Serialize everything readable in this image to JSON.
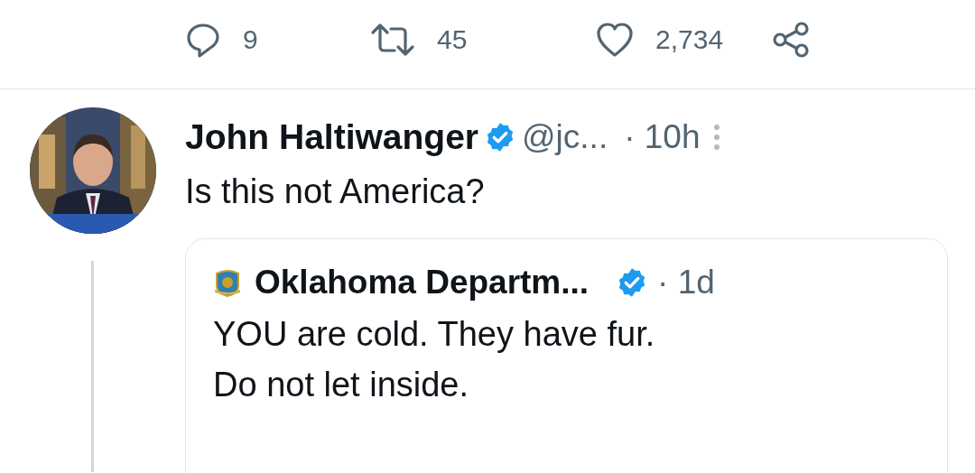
{
  "actions": [
    {
      "kind": "reply",
      "count": "9"
    },
    {
      "kind": "retweet",
      "count": "45"
    },
    {
      "kind": "like",
      "count": "2,734"
    },
    {
      "kind": "share"
    }
  ],
  "tweet": {
    "author": "John Haltiwanger",
    "verified": true,
    "handle": "@jc...",
    "time": "· 10h",
    "text": "Is this not America?",
    "quote": {
      "author": "Oklahoma Departm...",
      "verified": true,
      "time": "· 1d",
      "lines": [
        "YOU are cold. They have fur.",
        "Do not let inside."
      ]
    }
  }
}
